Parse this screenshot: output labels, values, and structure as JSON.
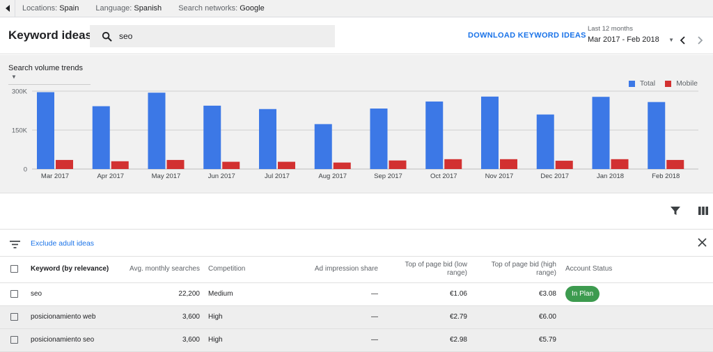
{
  "filters": {
    "locations_label": "Locations:",
    "locations_value": "Spain",
    "language_label": "Language:",
    "language_value": "Spanish",
    "networks_label": "Search networks:",
    "networks_value": "Google"
  },
  "header": {
    "title": "Keyword ideas",
    "search_value": "seo",
    "download_label": "DOWNLOAD KEYWORD IDEAS",
    "date_caption": "Last 12 months",
    "date_range": "Mar 2017 - Feb 2018"
  },
  "chart_panel": {
    "trend_selector": "Search volume trends"
  },
  "chart_data": {
    "type": "bar",
    "categories": [
      "Mar 2017",
      "Apr 2017",
      "May 2017",
      "Jun 2017",
      "Jul 2017",
      "Aug 2017",
      "Sep 2017",
      "Oct 2017",
      "Nov 2017",
      "Dec 2017",
      "Jan 2018",
      "Feb 2018"
    ],
    "series": [
      {
        "name": "Total",
        "color": "#3c78e6",
        "values": [
          296000,
          242000,
          294000,
          244000,
          231000,
          173000,
          233000,
          260000,
          279000,
          210000,
          278000,
          258000
        ]
      },
      {
        "name": "Mobile",
        "color": "#d23131",
        "values": [
          35000,
          30000,
          35000,
          28000,
          28000,
          25000,
          33000,
          38000,
          38000,
          32000,
          38000,
          35000
        ]
      }
    ],
    "ylim": [
      0,
      300000
    ],
    "yticks": [
      {
        "value": 0,
        "label": "0"
      },
      {
        "value": 150000,
        "label": "150K"
      },
      {
        "value": 300000,
        "label": "300K"
      }
    ],
    "legend": "top-right",
    "grid": true
  },
  "filter_row": {
    "exclude_label": "Exclude adult ideas"
  },
  "table": {
    "headers": {
      "keyword": "Keyword (by relevance)",
      "avg_searches": "Avg. monthly searches",
      "competition": "Competition",
      "ad_share": "Ad impression share",
      "bid_low_1": "Top of page bid (low",
      "bid_low_2": "range)",
      "bid_high_1": "Top of page bid (high",
      "bid_high_2": "range)",
      "status": "Account Status"
    },
    "rows": [
      {
        "keyword": "seo",
        "avg_searches": "22,200",
        "competition": "Medium",
        "ad_share": "—",
        "bid_low": "€1.06",
        "bid_high": "€3.08",
        "status": "In Plan"
      },
      {
        "keyword": "posicionamiento web",
        "avg_searches": "3,600",
        "competition": "High",
        "ad_share": "—",
        "bid_low": "€2.79",
        "bid_high": "€6.00",
        "status": ""
      },
      {
        "keyword": "posicionamiento seo",
        "avg_searches": "3,600",
        "competition": "High",
        "ad_share": "—",
        "bid_low": "€2.98",
        "bid_high": "€5.79",
        "status": ""
      }
    ]
  },
  "icons": {
    "back": "chevron-left-icon",
    "search": "search-icon",
    "dropdown": "triangle-down-icon",
    "prev": "chevron-left-icon",
    "next": "chevron-right-icon",
    "filter": "funnel-icon",
    "columns": "columns-icon",
    "filter_lines": "filter-list-icon",
    "close": "close-icon"
  }
}
